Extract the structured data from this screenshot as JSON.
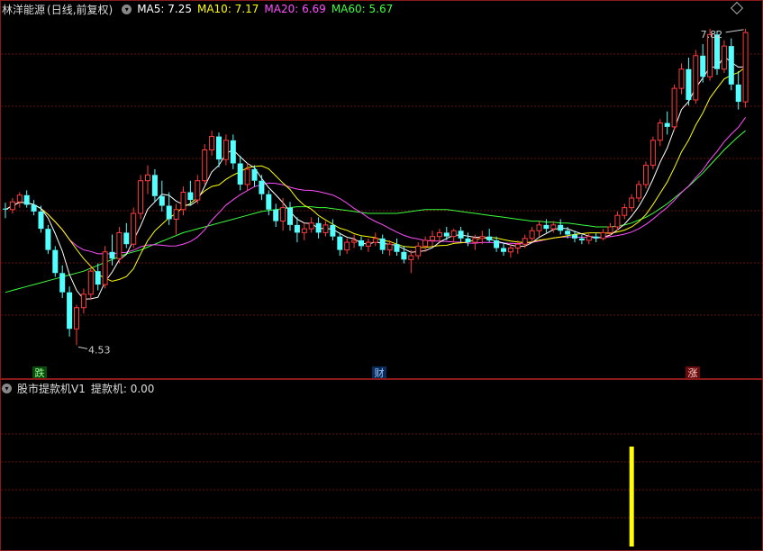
{
  "header": {
    "stock": "林洋能源",
    "mode": "(日线,前复权)",
    "ma5": "MA5: 7.25",
    "ma10": "MA10: 7.17",
    "ma20": "MA20: 6.69",
    "ma60": "MA60: 5.67"
  },
  "sub_header": {
    "name": "股市提款机V1",
    "value": "提款机: 0.00"
  },
  "colors": {
    "up": "#ff3c3c",
    "down": "#54ffff",
    "ma5": "#ffffff",
    "ma10": "#ffff00",
    "ma20": "#ff4dff",
    "ma60": "#3cff3c",
    "grid": "#6a1010",
    "signal": "#ffff00"
  },
  "chart_data": {
    "type": "candlestick",
    "ylim": [
      4.3,
      7.95
    ],
    "labels": {
      "high": "7.82",
      "low": "4.53",
      "markers": [
        "跌",
        "财",
        "涨"
      ]
    },
    "candles": [
      [
        5.95,
        6.01,
        5.85,
        5.94
      ],
      [
        5.94,
        6.06,
        5.9,
        6.02
      ],
      [
        6.02,
        6.12,
        5.96,
        6.09
      ],
      [
        6.09,
        6.14,
        5.96,
        5.99
      ],
      [
        5.99,
        6.04,
        5.88,
        5.92
      ],
      [
        5.92,
        5.98,
        5.7,
        5.74
      ],
      [
        5.74,
        5.78,
        5.48,
        5.52
      ],
      [
        5.52,
        5.56,
        5.24,
        5.28
      ],
      [
        5.28,
        5.36,
        5.02,
        5.08
      ],
      [
        5.08,
        5.14,
        4.62,
        4.7
      ],
      [
        4.7,
        4.95,
        4.53,
        4.92
      ],
      [
        4.92,
        5.12,
        4.86,
        5.06
      ],
      [
        5.06,
        5.36,
        5.0,
        5.3
      ],
      [
        5.3,
        5.38,
        5.1,
        5.16
      ],
      [
        5.16,
        5.56,
        5.12,
        5.5
      ],
      [
        5.5,
        5.68,
        5.36,
        5.43
      ],
      [
        5.43,
        5.76,
        5.38,
        5.7
      ],
      [
        5.7,
        5.8,
        5.54,
        5.58
      ],
      [
        5.58,
        5.96,
        5.54,
        5.9
      ],
      [
        5.9,
        6.3,
        5.84,
        6.24
      ],
      [
        6.24,
        6.4,
        6.1,
        6.3
      ],
      [
        6.3,
        6.36,
        6.02,
        6.08
      ],
      [
        6.08,
        6.24,
        5.92,
        5.98
      ],
      [
        5.98,
        6.12,
        5.78,
        5.84
      ],
      [
        5.84,
        6.0,
        5.68,
        5.94
      ],
      [
        5.94,
        6.18,
        5.88,
        6.12
      ],
      [
        6.12,
        6.24,
        5.98,
        6.04
      ],
      [
        6.04,
        6.3,
        6.0,
        6.24
      ],
      [
        6.24,
        6.62,
        6.2,
        6.56
      ],
      [
        6.56,
        6.76,
        6.5,
        6.7
      ],
      [
        6.7,
        6.74,
        6.38,
        6.46
      ],
      [
        6.46,
        6.72,
        6.4,
        6.66
      ],
      [
        6.66,
        6.72,
        6.36,
        6.42
      ],
      [
        6.42,
        6.5,
        6.14,
        6.2
      ],
      [
        6.2,
        6.42,
        6.14,
        6.36
      ],
      [
        6.36,
        6.4,
        6.18,
        6.24
      ],
      [
        6.24,
        6.3,
        6.04,
        6.1
      ],
      [
        6.1,
        6.14,
        5.88,
        5.94
      ],
      [
        5.94,
        6.0,
        5.76,
        5.82
      ],
      [
        5.82,
        6.06,
        5.72,
        5.96
      ],
      [
        5.96,
        6.02,
        5.72,
        5.78
      ],
      [
        5.78,
        5.86,
        5.6,
        5.7
      ],
      [
        5.7,
        5.8,
        5.62,
        5.74
      ],
      [
        5.74,
        5.86,
        5.7,
        5.8
      ],
      [
        5.8,
        5.86,
        5.64,
        5.7
      ],
      [
        5.7,
        5.82,
        5.66,
        5.78
      ],
      [
        5.78,
        5.84,
        5.62,
        5.66
      ],
      [
        5.66,
        5.7,
        5.46,
        5.52
      ],
      [
        5.52,
        5.64,
        5.48,
        5.6
      ],
      [
        5.6,
        5.68,
        5.54,
        5.62
      ],
      [
        5.62,
        5.66,
        5.52,
        5.56
      ],
      [
        5.56,
        5.64,
        5.5,
        5.6
      ],
      [
        5.6,
        5.7,
        5.56,
        5.64
      ],
      [
        5.64,
        5.68,
        5.48,
        5.52
      ],
      [
        5.52,
        5.62,
        5.46,
        5.58
      ],
      [
        5.58,
        5.64,
        5.46,
        5.5
      ],
      [
        5.5,
        5.56,
        5.38,
        5.42
      ],
      [
        5.42,
        5.52,
        5.28,
        5.46
      ],
      [
        5.46,
        5.6,
        5.42,
        5.56
      ],
      [
        5.56,
        5.66,
        5.5,
        5.62
      ],
      [
        5.62,
        5.72,
        5.56,
        5.66
      ],
      [
        5.66,
        5.74,
        5.6,
        5.7
      ],
      [
        5.7,
        5.76,
        5.62,
        5.66
      ],
      [
        5.66,
        5.74,
        5.6,
        5.72
      ],
      [
        5.72,
        5.76,
        5.6,
        5.64
      ],
      [
        5.64,
        5.7,
        5.56,
        5.6
      ],
      [
        5.6,
        5.68,
        5.52,
        5.64
      ],
      [
        5.64,
        5.72,
        5.58,
        5.66
      ],
      [
        5.66,
        5.74,
        5.6,
        5.62
      ],
      [
        5.62,
        5.66,
        5.5,
        5.54
      ],
      [
        5.54,
        5.6,
        5.46,
        5.5
      ],
      [
        5.5,
        5.58,
        5.44,
        5.54
      ],
      [
        5.54,
        5.62,
        5.48,
        5.58
      ],
      [
        5.58,
        5.68,
        5.54,
        5.64
      ],
      [
        5.64,
        5.76,
        5.6,
        5.72
      ],
      [
        5.72,
        5.82,
        5.66,
        5.78
      ],
      [
        5.78,
        5.84,
        5.7,
        5.74
      ],
      [
        5.74,
        5.82,
        5.7,
        5.78
      ],
      [
        5.78,
        5.84,
        5.68,
        5.72
      ],
      [
        5.72,
        5.76,
        5.64,
        5.68
      ],
      [
        5.68,
        5.72,
        5.6,
        5.64
      ],
      [
        5.64,
        5.68,
        5.58,
        5.62
      ],
      [
        5.62,
        5.7,
        5.58,
        5.66
      ],
      [
        5.66,
        5.7,
        5.6,
        5.64
      ],
      [
        5.64,
        5.74,
        5.62,
        5.7
      ],
      [
        5.7,
        5.8,
        5.66,
        5.76
      ],
      [
        5.76,
        5.92,
        5.72,
        5.88
      ],
      [
        5.88,
        6.0,
        5.84,
        5.96
      ],
      [
        5.96,
        6.1,
        5.92,
        6.06
      ],
      [
        6.06,
        6.24,
        6.02,
        6.2
      ],
      [
        6.2,
        6.44,
        6.16,
        6.4
      ],
      [
        6.4,
        6.7,
        6.36,
        6.66
      ],
      [
        6.66,
        6.88,
        6.6,
        6.84
      ],
      [
        6.84,
        6.96,
        6.72,
        6.8
      ],
      [
        6.8,
        7.24,
        6.76,
        7.2
      ],
      [
        7.2,
        7.46,
        7.14,
        7.4
      ],
      [
        7.4,
        7.52,
        7.02,
        7.08
      ],
      [
        7.08,
        7.6,
        7.04,
        7.54
      ],
      [
        7.54,
        7.66,
        7.26,
        7.32
      ],
      [
        7.32,
        7.82,
        7.28,
        7.76
      ],
      [
        7.76,
        7.8,
        7.34,
        7.4
      ],
      [
        7.4,
        7.7,
        7.36,
        7.64
      ],
      [
        7.64,
        7.72,
        7.18,
        7.24
      ],
      [
        7.24,
        7.38,
        6.98,
        7.06
      ],
      [
        7.06,
        7.82,
        7.0,
        7.78
      ]
    ],
    "ma60": [
      5.08,
      5.1,
      5.12,
      5.14,
      5.16,
      5.18,
      5.2,
      5.22,
      5.24,
      5.26,
      5.28,
      5.3,
      5.33,
      5.36,
      5.39,
      5.42,
      5.45,
      5.48,
      5.5,
      5.52,
      5.55,
      5.58,
      5.61,
      5.64,
      5.67,
      5.7,
      5.72,
      5.74,
      5.76,
      5.78,
      5.8,
      5.82,
      5.84,
      5.86,
      5.88,
      5.9,
      5.92,
      5.93,
      5.94,
      5.95,
      5.96,
      5.97,
      5.97,
      5.97,
      5.96,
      5.96,
      5.95,
      5.94,
      5.93,
      5.92,
      5.91,
      5.9,
      5.9,
      5.9,
      5.9,
      5.9,
      5.91,
      5.92,
      5.93,
      5.94,
      5.94,
      5.94,
      5.94,
      5.93,
      5.92,
      5.91,
      5.9,
      5.89,
      5.88,
      5.87,
      5.86,
      5.85,
      5.84,
      5.83,
      5.82,
      5.82,
      5.81,
      5.81,
      5.8,
      5.8,
      5.79,
      5.78,
      5.77,
      5.76,
      5.76,
      5.76,
      5.77,
      5.78,
      5.8,
      5.83,
      5.86,
      5.9,
      5.95,
      6.0,
      6.06,
      6.12,
      6.18,
      6.25,
      6.32,
      6.4,
      6.48,
      6.56,
      6.63,
      6.7,
      6.76
    ]
  },
  "signals": [
    {
      "index": 88,
      "value": 1.0
    }
  ]
}
